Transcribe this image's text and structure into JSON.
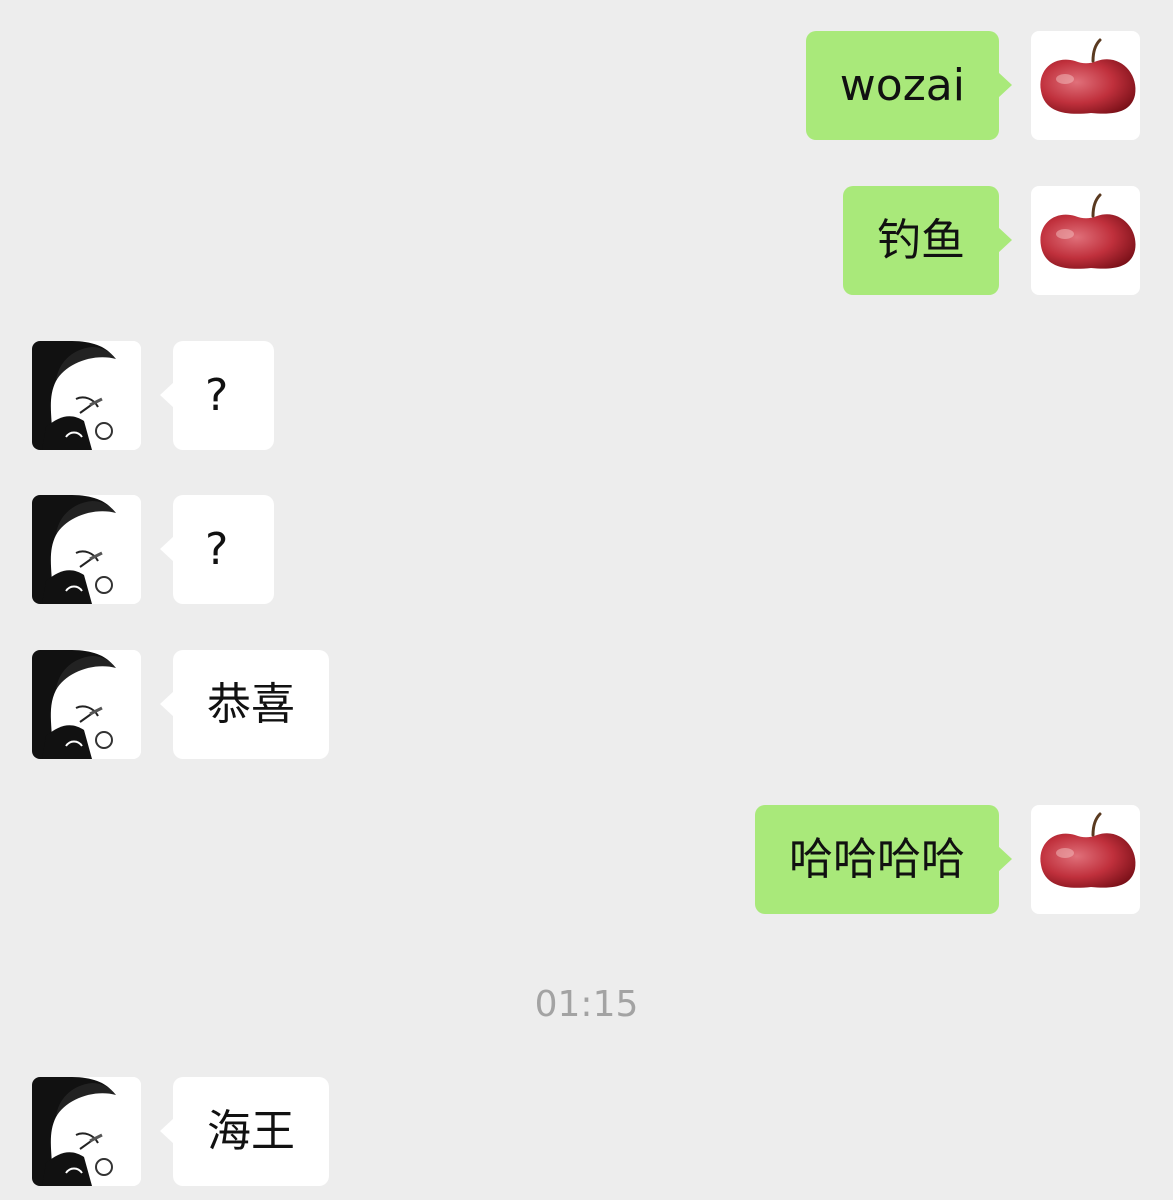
{
  "chat": {
    "messages": [
      {
        "side": "right",
        "text": "wozai",
        "avatar": "apple-avatar"
      },
      {
        "side": "right",
        "text": "钓鱼",
        "avatar": "apple-avatar"
      },
      {
        "side": "left",
        "text": "?",
        "avatar": "manga-avatar"
      },
      {
        "side": "left",
        "text": "?",
        "avatar": "manga-avatar"
      },
      {
        "side": "left",
        "text": "恭喜",
        "avatar": "manga-avatar"
      },
      {
        "side": "right",
        "text": "哈哈哈哈",
        "avatar": "apple-avatar"
      }
    ],
    "timestamp": "01:15",
    "after_timestamp": [
      {
        "side": "left",
        "text": "海王",
        "avatar": "manga-avatar"
      }
    ]
  },
  "colors": {
    "background": "#ededed",
    "sent_bubble": "#a9e97a",
    "received_bubble": "#ffffff",
    "timestamp_text": "#a3a3a3"
  }
}
